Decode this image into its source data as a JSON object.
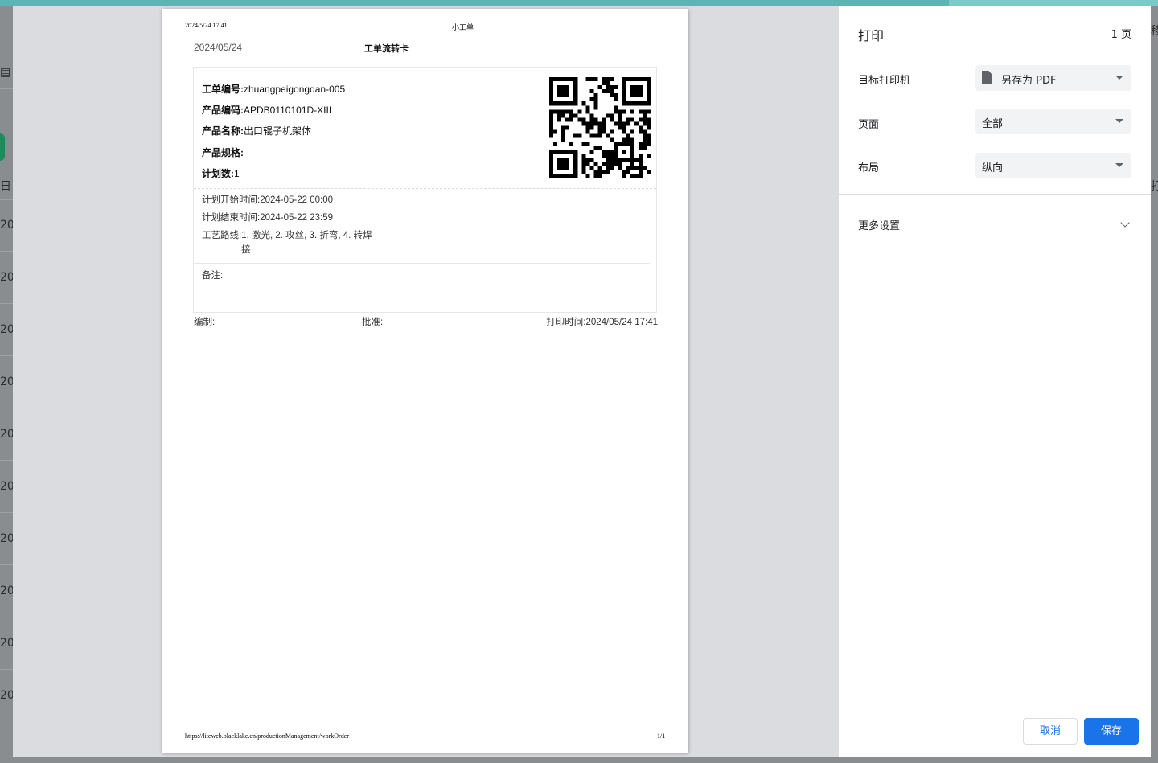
{
  "background": {
    "left_glyphs": [
      "日",
      "20",
      "20",
      "20",
      "20",
      "20",
      "20",
      "20",
      "20",
      "20",
      "20"
    ],
    "right_glyphs": [
      "移",
      "打"
    ]
  },
  "preview": {
    "header": {
      "datetime": "2024/5/24 17:41",
      "title": "小工单"
    },
    "footer": {
      "url": "https://liteweb.blacklake.cn/productionManagement/workOrder",
      "page": "1/1"
    },
    "card": {
      "date": "2024/05/24",
      "title": "工单流转卡",
      "fields": [
        {
          "label": "工单编号:",
          "value": "zhuangpeigongdan-005"
        },
        {
          "label": "产品编码:",
          "value": "APDB0110101D-XIII"
        },
        {
          "label": "产品名称:",
          "value": "出口辊子机架体"
        },
        {
          "label": "产品规格:",
          "value": ""
        },
        {
          "label": "计划数:",
          "value": "1"
        }
      ],
      "plan_start": {
        "label": "计划开始时间:",
        "value": "2024-05-22 00:00"
      },
      "plan_end": {
        "label": "计划结束时间:",
        "value": "2024-05-22 23:59"
      },
      "route": {
        "label": "工艺路线:",
        "value": "1. 激光, 2. 攻丝, 3. 折弯, 4. 转焊接"
      },
      "remark": {
        "label": "备注:"
      },
      "compiled_by": "编制:",
      "approved_by": "批准:",
      "print_time": {
        "label": "打印时间:",
        "value": "2024/05/24 17:41"
      }
    }
  },
  "panel": {
    "title": "打印",
    "page_count": "1 页",
    "printer": {
      "label": "目标打印机",
      "value": "另存为 PDF",
      "icon": "file-icon"
    },
    "pages": {
      "label": "页面",
      "value": "全部"
    },
    "layout": {
      "label": "布局",
      "value": "纵向"
    },
    "more_settings": "更多设置",
    "cancel_label": "取消",
    "save_label": "保存",
    "accent_color": "#1a73e8"
  }
}
